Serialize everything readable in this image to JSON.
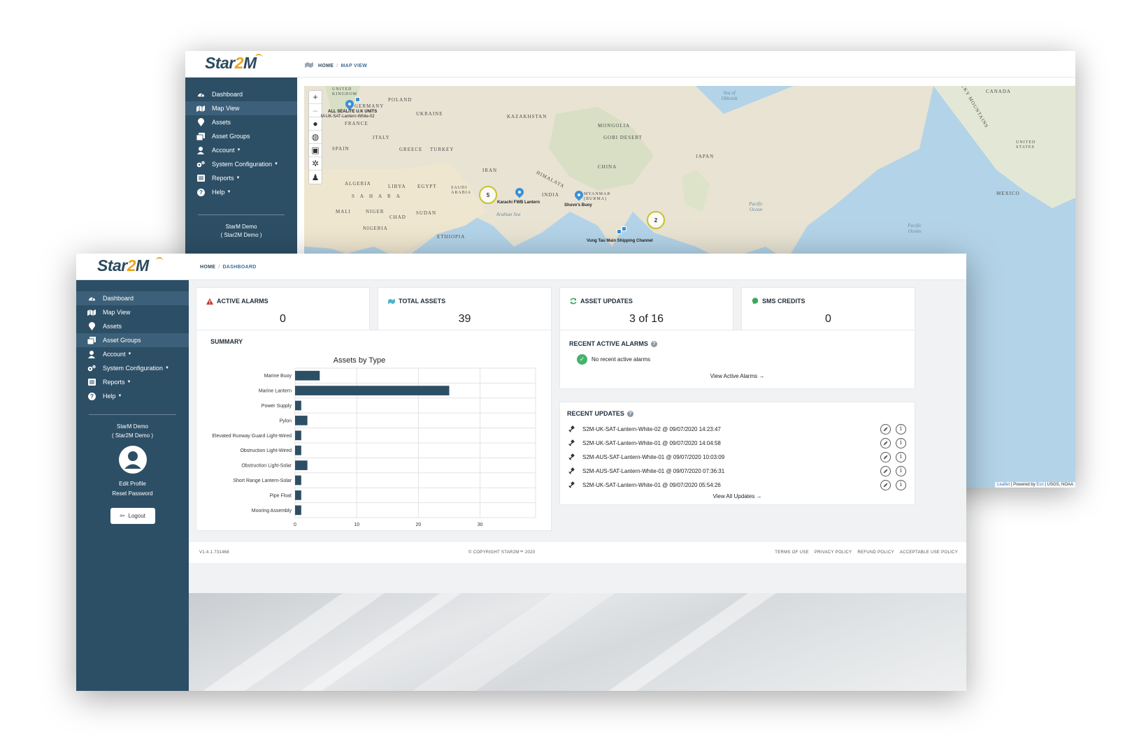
{
  "back_window": {
    "logo": {
      "star": "Star",
      "two": "2",
      "m": "M"
    },
    "breadcrumb": {
      "home": "HOME",
      "separator": "/",
      "current": "MAP VIEW"
    },
    "sidebar": {
      "items": [
        {
          "label": "Dashboard",
          "icon": "dashboard-icon"
        },
        {
          "label": "Map View",
          "icon": "map-icon"
        },
        {
          "label": "Assets",
          "icon": "map-marker-icon"
        },
        {
          "label": "Asset Groups",
          "icon": "copy-icon"
        },
        {
          "label": "Account",
          "icon": "user-icon"
        },
        {
          "label": "System Configuration",
          "icon": "cogs-icon"
        },
        {
          "label": "Reports",
          "icon": "list-icon"
        },
        {
          "label": "Help",
          "icon": "question-icon"
        }
      ],
      "user_name": "StarM Demo",
      "user_org": "( Star2M Demo )"
    },
    "map": {
      "zoom_in": "+",
      "zoom_out": "–",
      "labels": [
        "UNITED KINGDOM",
        "POLAND",
        "GERMANY",
        "UKRAINE",
        "KAZAKHSTAN",
        "MONGOLIA",
        "GOBI DESERT",
        "FRANCE",
        "ITALY",
        "SPAIN",
        "GREECE",
        "TURKEY",
        "IRAN",
        "CHINA",
        "JAPAN",
        "HIMALAYA",
        "ALGERIA",
        "LIBYA",
        "EGYPT",
        "SAUDI ARABIA",
        "INDIA",
        "MYANMAR (BURMA)",
        "SAHARA",
        "MALI",
        "NIGER",
        "CHAD",
        "SUDAN",
        "NIGERIA",
        "ETHIOPIA",
        "CANADA",
        "UNITED STATES",
        "MEXICO",
        "ROCKY MOUNTAINS"
      ],
      "sea_labels": [
        "Sea of Okhotsk",
        "Pacific Ocean",
        "Pacific Ocean",
        "Arabian Sea"
      ],
      "markers": [
        "ALL SEALITE U.K UNITS",
        "M-UK-SAT-Lantern-White-02",
        "Karachi FWB Lantern",
        "Shuvo's Buoy",
        "Vung Tau Main Shipping Channel"
      ],
      "clusters": [
        "5",
        "2"
      ],
      "attribution": {
        "leaflet": "Leaflet",
        "sep1": " | Powered by ",
        "esri": "Esri",
        "rest": " | USGS, NOAA"
      }
    }
  },
  "front_window": {
    "logo": {
      "star": "Star",
      "two": "2",
      "m": "M"
    },
    "breadcrumb": {
      "home": "HOME",
      "separator": "/",
      "current": "DASHBOARD"
    },
    "sidebar": {
      "items": [
        {
          "label": "Dashboard",
          "icon": "dashboard-icon",
          "active": true
        },
        {
          "label": "Map View",
          "icon": "map-icon"
        },
        {
          "label": "Assets",
          "icon": "map-marker-icon"
        },
        {
          "label": "Asset Groups",
          "icon": "copy-icon",
          "active": true
        },
        {
          "label": "Account",
          "icon": "user-icon",
          "dropdown": true
        },
        {
          "label": "System Configuration",
          "icon": "cogs-icon",
          "dropdown": true
        },
        {
          "label": "Reports",
          "icon": "list-icon",
          "dropdown": true
        },
        {
          "label": "Help",
          "icon": "question-icon",
          "dropdown": true
        }
      ],
      "user_name": "StarM Demo",
      "user_org": "( Star2M Demo )",
      "edit_profile": "Edit Profile",
      "reset_password": "Reset Password",
      "logout": "Logout"
    },
    "stats": [
      {
        "title": "ACTIVE ALARMS",
        "value": "0",
        "icon": "warning-icon",
        "color": "#c0392b"
      },
      {
        "title": "TOTAL ASSETS",
        "value": "39",
        "icon": "map-icon",
        "color": "#4fb3c9"
      },
      {
        "title": "ASSET UPDATES",
        "value": "3 of 16",
        "icon": "refresh-icon",
        "color": "#3aa85a"
      },
      {
        "title": "SMS CREDITS",
        "value": "0",
        "icon": "chat-icon",
        "color": "#3aa85a"
      }
    ],
    "summary": {
      "title": "SUMMARY"
    },
    "recent_alarms": {
      "title": "RECENT ACTIVE ALARMS",
      "empty_text": "No recent active alarms",
      "link": "View Active Alarms →"
    },
    "recent_updates": {
      "title": "RECENT UPDATES",
      "rows": [
        "S2M-UK-SAT-Lantern-White-02 @ 09/07/2020 14:23:47",
        "S2M-UK-SAT-Lantern-White-01 @ 09/07/2020 14:04:58",
        "S2M-AUS-SAT-Lantern-White-01 @ 09/07/2020 10:03:09",
        "S2M-AUS-SAT-Lantern-White-01 @ 09/07/2020 07:36:31",
        "S2M-UK-SAT-Lantern-White-01 @ 09/07/2020 05:54:26"
      ],
      "link": "View All Updates →"
    },
    "footer": {
      "version": "V1.4.1.731468",
      "copyright": "© COPYRIGHT STAR2M™ 2020",
      "links": [
        "TERMS OF USE",
        "PRIVACY POLICY",
        "REFUND POLICY",
        "ACCEPTABLE USE POLICY"
      ]
    }
  },
  "chart_data": {
    "type": "bar",
    "orientation": "horizontal",
    "title": "Assets by Type",
    "categories": [
      "Marine Buoy",
      "Marine Lantern",
      "Power Supply",
      "Pylon",
      "Elevated Runway Guard Light-Wired",
      "Obstruction Light-Wired",
      "Obstruction Light-Solar",
      "Short Range Lantern-Solar",
      "Pipe Float",
      "Mooring Assembly"
    ],
    "values": [
      4,
      25,
      1,
      2,
      1,
      1,
      2,
      1,
      1,
      1
    ],
    "xlim": [
      0,
      39
    ],
    "xticks": [
      0,
      10,
      20,
      30
    ],
    "grid": true,
    "color": "#2d4f66"
  }
}
